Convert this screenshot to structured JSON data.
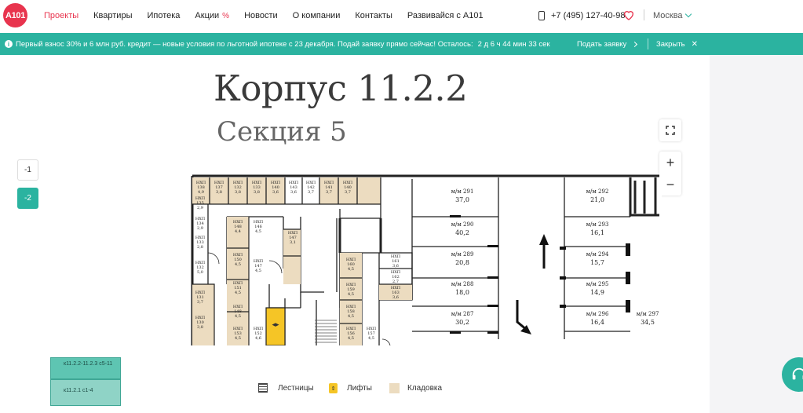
{
  "header": {
    "logo": "A101",
    "nav": [
      {
        "label": "Проекты"
      },
      {
        "label": "Квартиры"
      },
      {
        "label": "Ипотека"
      },
      {
        "label": "Акции"
      },
      {
        "label": "Новости"
      },
      {
        "label": "О компании"
      },
      {
        "label": "Контакты"
      },
      {
        "label": "Развивайся с А101"
      }
    ],
    "promo_badge": "%",
    "phone": "+7 (495) 127-40-98",
    "city": "Москва"
  },
  "banner": {
    "text": "Первый взнос 30% и 6 млн руб. кредит — новые условия по льготной ипотеке с 23 декабря. Подай заявку прямо сейчас! Осталось:",
    "timer": "2 д 6 ч 44 мин 33 сек",
    "apply_label": "Подать заявку",
    "close_label": "Закрыть"
  },
  "building": {
    "title": "Корпус 11.2.2",
    "section": "Секция 5"
  },
  "floors": [
    {
      "label": "-1",
      "active": false
    },
    {
      "label": "-2",
      "active": true
    }
  ],
  "controls": {
    "zoom_in": "+",
    "zoom_out": "−"
  },
  "plan": {
    "storage_label": "НХП",
    "parking_spots": [
      {
        "id": "м/м 291",
        "area": "37,0"
      },
      {
        "id": "м/м 290",
        "area": "40,2"
      },
      {
        "id": "м/м 289",
        "area": "20,8"
      },
      {
        "id": "м/м 288",
        "area": "18,0"
      },
      {
        "id": "м/м 287",
        "area": "30,2"
      },
      {
        "id": "м/м 292",
        "area": "21,0"
      },
      {
        "id": "м/м 293",
        "area": "16,1"
      },
      {
        "id": "м/м 294",
        "area": "15,7"
      },
      {
        "id": "м/м 295",
        "area": "14,9"
      },
      {
        "id": "м/м 296",
        "area": "16,4"
      },
      {
        "id": "м/м 297",
        "area": "34,5"
      }
    ],
    "storages_top": [
      {
        "n": "138",
        "a": "4,9"
      },
      {
        "n": "137",
        "a": "3,8"
      },
      {
        "n": "132",
        "a": "3,8"
      },
      {
        "n": "133",
        "a": "3,8"
      },
      {
        "n": "140",
        "a": "3,6"
      },
      {
        "n": "143",
        "a": "3,6"
      },
      {
        "n": "142",
        "a": "3,7"
      },
      {
        "n": "141",
        "a": "3,7"
      },
      {
        "n": "140",
        "a": "3,7"
      }
    ],
    "storages_left": [
      {
        "n": "135",
        "a": "2,9"
      },
      {
        "n": "134",
        "a": "2,9"
      },
      {
        "n": "133",
        "a": "2,8"
      },
      {
        "n": "132",
        "a": "5,0"
      },
      {
        "n": "131",
        "a": "3,7"
      },
      {
        "n": "130",
        "a": "3,8"
      }
    ],
    "storages_mid": [
      {
        "n": "148",
        "a": "4,4"
      },
      {
        "n": "146",
        "a": "4,5"
      },
      {
        "n": "147",
        "a": "3,1"
      },
      {
        "n": "147",
        "a": "4,5"
      },
      {
        "n": "150",
        "a": "4,5"
      },
      {
        "n": "151",
        "a": "4,5"
      },
      {
        "n": "148",
        "a": "4,5"
      },
      {
        "n": "153",
        "a": "4,5"
      },
      {
        "n": "152",
        "a": "4,6"
      }
    ],
    "storages_right": [
      {
        "n": "160",
        "a": "4,5"
      },
      {
        "n": "159",
        "a": "4,5"
      },
      {
        "n": "158",
        "a": "4,5"
      },
      {
        "n": "156",
        "a": "4,5"
      },
      {
        "n": "157",
        "a": "4,5"
      },
      {
        "n": "161",
        "a": "3,6"
      },
      {
        "n": "162",
        "a": "2,7"
      },
      {
        "n": "163",
        "a": "3,6"
      }
    ]
  },
  "minimap": {
    "top_label": "к11.2.2-11.2.3 с5-11",
    "bottom_label": "к11.2.1 с1-4"
  },
  "legend": {
    "stairs": "Лестницы",
    "lifts": "Лифты",
    "storage": "Кладовка"
  }
}
